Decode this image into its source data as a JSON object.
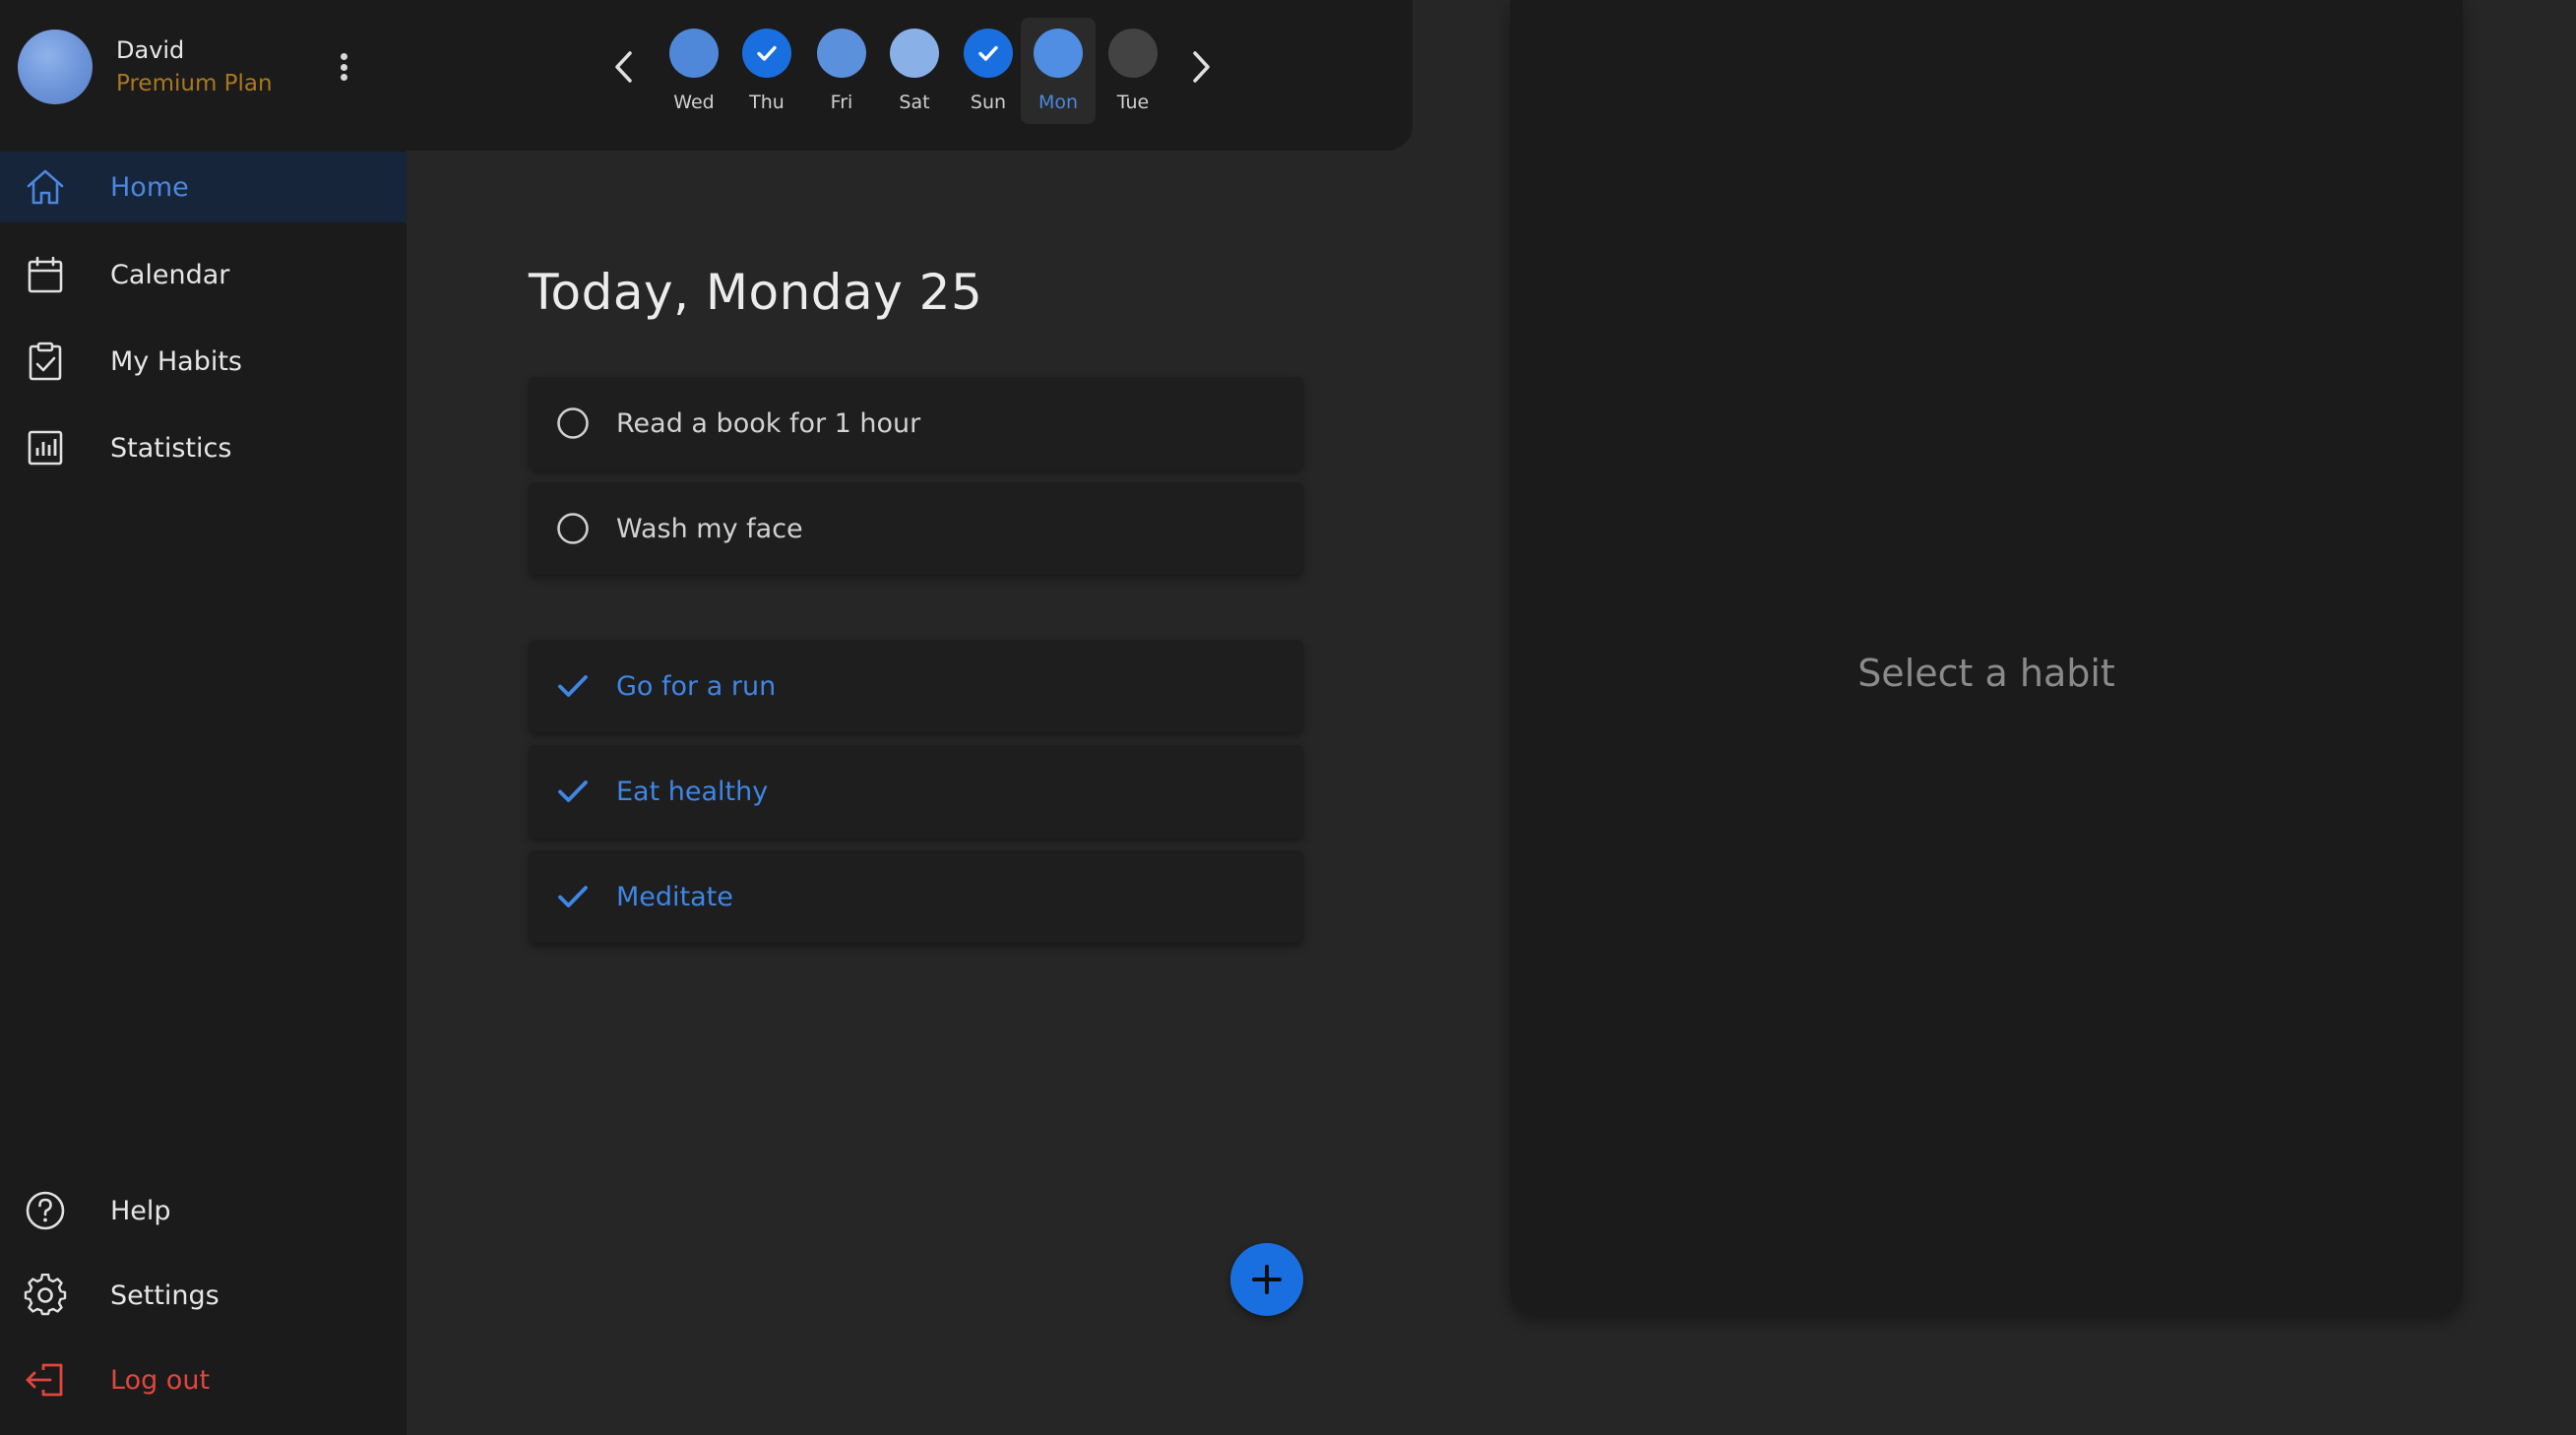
{
  "user": {
    "name": "David",
    "plan": "Premium Plan"
  },
  "colors": {
    "accent": "#3f86e6",
    "plan": "#a9781e",
    "logout": "#e0463f",
    "selected_nav_bg": "#16253a",
    "check_blue": "#1a6fe0"
  },
  "day_strip": {
    "prev_icon": "chevron-left-icon",
    "next_icon": "chevron-right-icon",
    "days": [
      {
        "label": "Wed",
        "state": "partial"
      },
      {
        "label": "Thu",
        "state": "complete"
      },
      {
        "label": "Fri",
        "state": "partial"
      },
      {
        "label": "Sat",
        "state": "partial"
      },
      {
        "label": "Sun",
        "state": "complete"
      },
      {
        "label": "Mon",
        "state": "partial",
        "active": true
      },
      {
        "label": "Tue",
        "state": "empty"
      }
    ]
  },
  "sidebar": {
    "items": [
      {
        "label": "Home",
        "icon": "home-icon",
        "selected": true
      },
      {
        "label": "Calendar",
        "icon": "calendar-icon"
      },
      {
        "label": "My Habits",
        "icon": "clipboard-check-icon"
      },
      {
        "label": "Statistics",
        "icon": "bar-chart-icon"
      }
    ],
    "bottom_items": [
      {
        "label": "Help",
        "icon": "help-icon"
      },
      {
        "label": "Settings",
        "icon": "gear-icon"
      },
      {
        "label": "Log out",
        "icon": "logout-icon"
      }
    ]
  },
  "main": {
    "title": "Today, Monday 25",
    "pending_habits": [
      {
        "name": "Read a book for 1 hour",
        "done": false
      },
      {
        "name": "Wash my face",
        "done": false
      }
    ],
    "completed_habits": [
      {
        "name": "Go for a run",
        "done": true
      },
      {
        "name": "Eat healthy",
        "done": true
      },
      {
        "name": "Meditate",
        "done": true
      }
    ],
    "add_button_icon": "plus-icon"
  },
  "detail": {
    "empty_text": "Select a habit"
  }
}
